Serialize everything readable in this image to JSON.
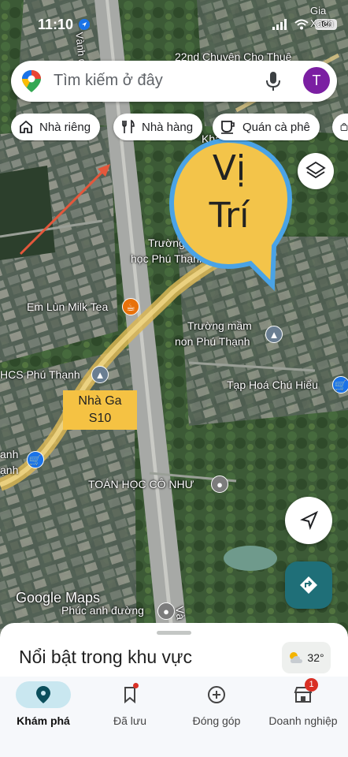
{
  "status_bar": {
    "time": "11:10",
    "carrier_corner": "Gia Xách",
    "battery": "84"
  },
  "search": {
    "placeholder": "Tìm kiếm ở đây",
    "avatar_letter": "T"
  },
  "chips": [
    {
      "label": "Nhà riêng",
      "icon": "home-icon"
    },
    {
      "label": "Nhà hàng",
      "icon": "restaurant-icon"
    },
    {
      "label": "Quán cà phê",
      "icon": "coffee-icon"
    }
  ],
  "map": {
    "road_label": "Vành đai 3",
    "road_label_bottom": "Và",
    "places": {
      "shop_top": "22nd Chuyên Cho Thuê",
      "school_elem_1": "Trường Ti",
      "school_elem_2": "học Phú Thạnh",
      "milk_tea": "Em Lùn Milk Tea",
      "kindergarten_1": "Trường mầm",
      "kindergarten_2": "non Phú Thạnh",
      "grocery": "Tạp Hoá Chú Hiểu",
      "thcs": "HCS Phú Thạnh",
      "left_shop_1": "anh",
      "left_shop_2": "ạnh",
      "math": "TOÁN HỌC CÔ NHƯ",
      "pharmacy": "Phúc anh đường",
      "kha": "Kha"
    },
    "station": {
      "line1": "Nhà Ga",
      "line2": "S10"
    },
    "annotation": {
      "line1": "Vị",
      "line2": "Trí"
    },
    "watermark": "Google Maps"
  },
  "bottom_sheet": {
    "title": "Nổi bật trong khu vực",
    "temperature": "32°"
  },
  "tabs": [
    {
      "label": "Khám phá",
      "icon": "explore-pin-icon",
      "active": true
    },
    {
      "label": "Đã lưu",
      "icon": "bookmark-icon",
      "active": false
    },
    {
      "label": "Đóng góp",
      "icon": "add-circle-icon",
      "active": false
    },
    {
      "label": "Doanh nghiệp",
      "icon": "business-icon",
      "active": false,
      "badge": "1"
    }
  ],
  "colors": {
    "accent": "#1a73e8",
    "station": "#f5c243",
    "avatar": "#7b1fa2",
    "annotation_fill": "#f3c44a",
    "annotation_stroke": "#4aa3e6"
  }
}
